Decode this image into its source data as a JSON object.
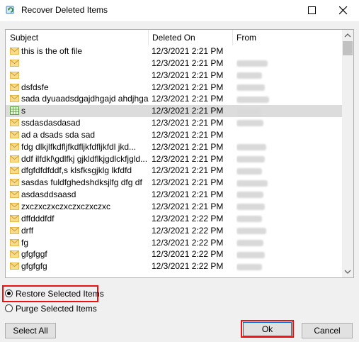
{
  "window": {
    "title": "Recover Deleted Items"
  },
  "columns": {
    "subject": "Subject",
    "deleted_on": "Deleted On",
    "from": "From"
  },
  "rows": [
    {
      "subject": "this is the oft file",
      "date": "12/3/2021 2:21 PM",
      "icon": "envelope-icon"
    },
    {
      "subject": "",
      "date": "12/3/2021 2:21 PM",
      "icon": "envelope-icon"
    },
    {
      "subject": "",
      "date": "12/3/2021 2:21 PM",
      "icon": "envelope-icon"
    },
    {
      "subject": "dsfdsfe",
      "date": "12/3/2021 2:21 PM",
      "icon": "envelope-icon"
    },
    {
      "subject": "sada dyuaadsdgajdhgajd ahdjhga...",
      "date": "12/3/2021 2:21 PM",
      "icon": "envelope-icon"
    },
    {
      "subject": "s",
      "date": "12/3/2021 2:21 PM",
      "icon": "calendar-grid-icon"
    },
    {
      "subject": "ssdasdasdasad",
      "date": "12/3/2021 2:21 PM",
      "icon": "envelope-icon"
    },
    {
      "subject": "ad a dsads sda sad",
      "date": "12/3/2021 2:21 PM",
      "icon": "envelope-icon"
    },
    {
      "subject": "fdg dlkjlfkdfljfkdfljkfdfljkfdl jkd...",
      "date": "12/3/2021 2:21 PM",
      "icon": "envelope-icon"
    },
    {
      "subject": "ddf ilfdkl\\gdlfkj gjkldflkjgdlckfjgld...",
      "date": "12/3/2021 2:21 PM",
      "icon": "envelope-icon"
    },
    {
      "subject": "dfgfdfdfddf,s klsfksgjklg lkfdfd",
      "date": "12/3/2021 2:21 PM",
      "icon": "envelope-icon"
    },
    {
      "subject": "sasdas fuldfghedshdksjlfg dfg df",
      "date": "12/3/2021 2:21 PM",
      "icon": "envelope-icon"
    },
    {
      "subject": "asdasddsaasd",
      "date": "12/3/2021 2:21 PM",
      "icon": "envelope-icon"
    },
    {
      "subject": "zxczxczxczxczxczxczxc",
      "date": "12/3/2021 2:21 PM",
      "icon": "envelope-icon"
    },
    {
      "subject": "dffdddfdf",
      "date": "12/3/2021 2:22 PM",
      "icon": "envelope-icon"
    },
    {
      "subject": "drff",
      "date": "12/3/2021 2:22 PM",
      "icon": "envelope-icon"
    },
    {
      "subject": "fg",
      "date": "12/3/2021 2:22 PM",
      "icon": "envelope-icon"
    },
    {
      "subject": "gfgfggf",
      "date": "12/3/2021 2:22 PM",
      "icon": "envelope-icon"
    },
    {
      "subject": "gfgfgfg",
      "date": "12/3/2021 2:22 PM",
      "icon": "envelope-icon"
    }
  ],
  "options": {
    "restore_label": "Restore Selected Items",
    "purge_label": "Purge Selected Items",
    "selected": "restore"
  },
  "buttons": {
    "select_all": "Select All",
    "ok": "Ok",
    "cancel": "Cancel"
  },
  "colors": {
    "highlight": "#ee1111",
    "envelope": "#e8b84a",
    "default_button_border": "#0078d7"
  }
}
